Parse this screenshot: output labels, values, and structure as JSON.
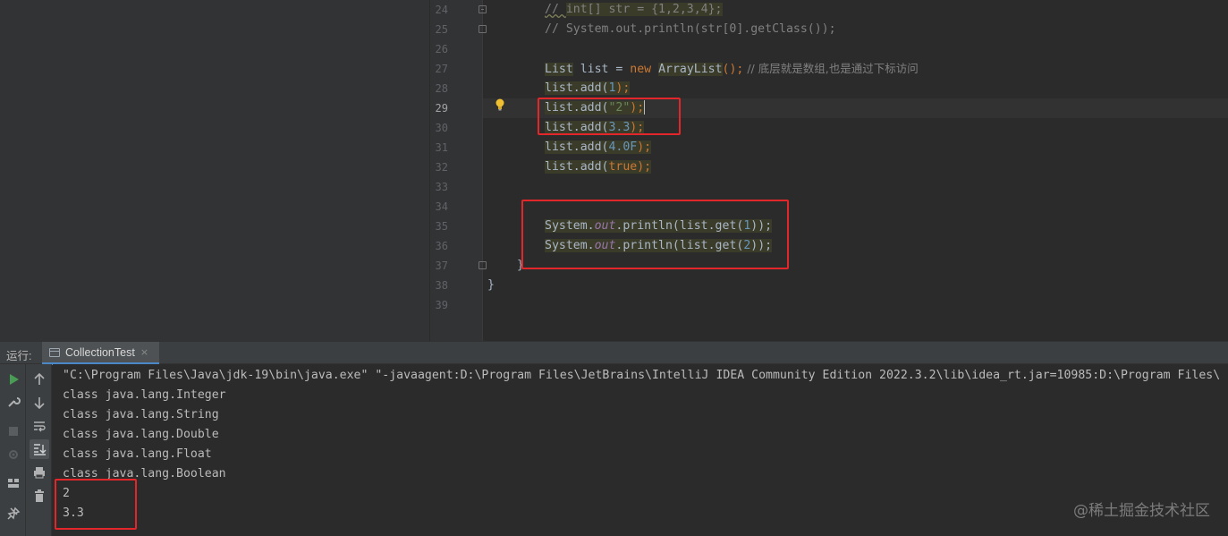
{
  "editor": {
    "line_numbers": [
      "24",
      "25",
      "26",
      "27",
      "28",
      "29",
      "30",
      "31",
      "32",
      "33",
      "34",
      "35",
      "36",
      "37",
      "38",
      "39"
    ],
    "current_line": "29",
    "lines": {
      "l24": {
        "prefix": "// ",
        "text": "int[] str = {1,2,3,4};"
      },
      "l25": {
        "text": "// System.out.println(str[0].getClass());"
      },
      "l27": {
        "type1": "List",
        "sp1": " list = ",
        "kw_new": "new",
        "sp2": " ",
        "type2": "ArrayList",
        "paren": "();",
        "comment": " // 底层就是数组,也是通过下标访问"
      },
      "l28": {
        "obj": "list",
        "call": ".add(",
        "arg": "1",
        "end": ");"
      },
      "l29": {
        "obj": "list",
        "call": ".add(",
        "arg": "\"2\"",
        "end": ");"
      },
      "l30": {
        "obj": "list",
        "call": ".add(",
        "arg": "3.3",
        "end": ");"
      },
      "l31": {
        "obj": "list",
        "call": ".add(",
        "arg": "4.0F",
        "end": ");"
      },
      "l32": {
        "obj": "list",
        "call": ".add(",
        "arg": "true",
        "end": ");"
      },
      "l35": {
        "cls": "System.",
        "field": "out",
        "mid": ".println(list.get(",
        "arg": "1",
        "end": "));"
      },
      "l36": {
        "cls": "System.",
        "field": "out",
        "mid": ".println(list.get(",
        "arg": "2",
        "end": "));"
      },
      "l37": "}",
      "l38": "}"
    }
  },
  "run_window": {
    "label": "运行:",
    "tab_label": "CollectionTest",
    "tab_close": "×",
    "console": [
      "\"C:\\Program Files\\Java\\jdk-19\\bin\\java.exe\" \"-javaagent:D:\\Program Files\\JetBrains\\IntelliJ IDEA Community Edition 2022.3.2\\lib\\idea_rt.jar=10985:D:\\Program Files\\",
      "class java.lang.Integer",
      "class java.lang.String",
      "class java.lang.Double",
      "class java.lang.Float",
      "class java.lang.Boolean",
      "2",
      "3.3"
    ],
    "toolbar_left": [
      "run-icon",
      "wrench-icon",
      "stop-icon",
      "debug-settings-icon",
      "layout-icon",
      "pin-icon"
    ],
    "toolbar_mid": [
      "arrow-up-icon",
      "arrow-down-icon",
      "soft-wrap-icon",
      "scroll-to-end-icon",
      "print-icon",
      "trash-icon"
    ]
  },
  "watermark": "@稀土掘金技术社区",
  "colors": {
    "keyword": "#cc7832",
    "number": "#6897bb",
    "string": "#6a8759",
    "comment": "#808080",
    "field": "#9876aa",
    "highlight_box": "#e2262a",
    "run_green": "#499c54"
  }
}
